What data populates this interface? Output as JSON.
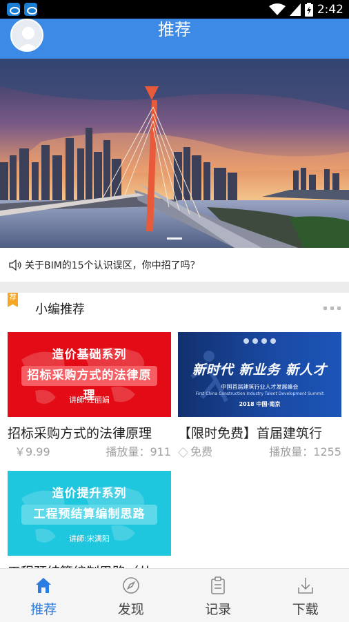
{
  "status_bar": {
    "time": "2:42"
  },
  "header": {
    "title": "推荐"
  },
  "notice": {
    "text": "关于BIM的15个认识误区，你中招了吗？"
  },
  "section": {
    "badge": "荐",
    "title": "小编推荐"
  },
  "courses": [
    {
      "thumb_series": "造价基础系列",
      "thumb_topic": "招标采购方式的法律原理",
      "thumb_lecturer": "讲師:汪丽娟",
      "title": "招标采购方式的法律原理",
      "price": "￥9.99",
      "plays": "播放量：911"
    },
    {
      "thumb_headline": "新时代  新业务  新人才",
      "thumb_sub1": "中国首届建筑行业人才发展峰会",
      "thumb_sub2": "First China Construction Industry Talent Development Summit",
      "thumb_sub3": "2018 中国·南京",
      "title": "【限时免费】首届建筑行",
      "price": "免费",
      "plays": "播放量：1255"
    },
    {
      "thumb_series": "造价提升系列",
      "thumb_topic": "工程预结算编制思路",
      "thumb_lecturer": "讲師:宋满阳",
      "title": "工程预结算编制思路（从"
    }
  ],
  "tabs": [
    {
      "label": "推荐",
      "icon": "home-icon",
      "active": true
    },
    {
      "label": "发现",
      "icon": "compass-icon",
      "active": false
    },
    {
      "label": "记录",
      "icon": "clipboard-icon",
      "active": false
    },
    {
      "label": "下载",
      "icon": "download-icon",
      "active": false
    }
  ],
  "colors": {
    "primary": "#3d8ae6",
    "accent_tab": "#2a7ce0",
    "badge": "#f5a623"
  }
}
